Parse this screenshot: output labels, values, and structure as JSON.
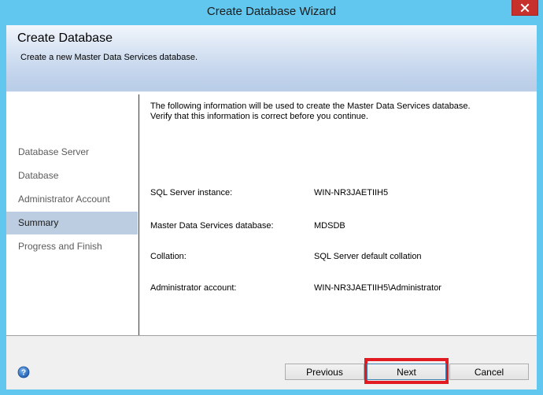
{
  "window": {
    "title": "Create Database Wizard"
  },
  "header": {
    "title": "Create Database",
    "subtitle": "Create a new Master Data Services database."
  },
  "nav": {
    "items": [
      {
        "label": "Database Server"
      },
      {
        "label": "Database"
      },
      {
        "label": "Administrator Account"
      },
      {
        "label": "Summary"
      },
      {
        "label": "Progress and Finish"
      }
    ],
    "active_index": 3
  },
  "content": {
    "intro_line1": "The following information will be used to create the Master Data Services database.",
    "intro_line2": "Verify that this information is correct before you continue.",
    "rows": [
      {
        "label": "SQL Server instance:",
        "value": "WIN-NR3JAETIIH5"
      },
      {
        "label": "Master Data Services database:",
        "value": "MDSDB"
      },
      {
        "label": "Collation:",
        "value": "SQL Server default collation"
      },
      {
        "label": "Administrator account:",
        "value": "WIN-NR3JAETIIH5\\Administrator"
      }
    ]
  },
  "footer": {
    "help_icon": "help-icon",
    "previous_label": "Previous",
    "next_label": "Next",
    "cancel_label": "Cancel"
  },
  "colors": {
    "titlebar": "#62c7ee",
    "close_button": "#c7302b",
    "active_nav": "#bccde2",
    "highlight": "#e21b23"
  }
}
